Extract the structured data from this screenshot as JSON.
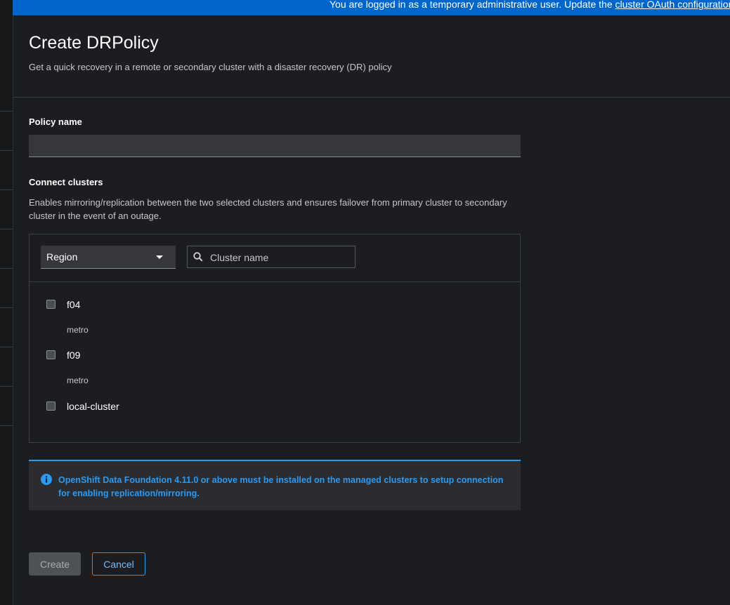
{
  "banner": {
    "text": "You are logged in as a temporary administrative user. Update the ",
    "link": "cluster OAuth configuration"
  },
  "header": {
    "title": "Create DRPolicy",
    "subtitle": "Get a quick recovery in a remote or secondary cluster with a disaster recovery (DR) policy"
  },
  "policy_name": {
    "label": "Policy name",
    "value": "",
    "placeholder": ""
  },
  "connect_clusters": {
    "label": "Connect clusters",
    "helper": "Enables mirroring/replication between the two selected clusters and ensures failover from primary cluster to secondary cluster in the event of an outage.",
    "filter": {
      "selected": "Region"
    },
    "search": {
      "placeholder": "Cluster name"
    },
    "items": [
      {
        "name": "f04",
        "region": "metro",
        "checked": false
      },
      {
        "name": "f09",
        "region": "metro",
        "checked": false
      },
      {
        "name": "local-cluster",
        "region": "",
        "checked": false
      }
    ]
  },
  "alert": {
    "message": "OpenShift Data Foundation 4.11.0 or above must be installed on the managed clusters to setup connection for enabling replication/mirroring."
  },
  "actions": {
    "create_label": "Create",
    "cancel_label": "Cancel"
  },
  "colors": {
    "banner": "#0066cc",
    "background": "#1b1d21",
    "alert_info": "#2b9af3",
    "link": "#73bcf7"
  }
}
